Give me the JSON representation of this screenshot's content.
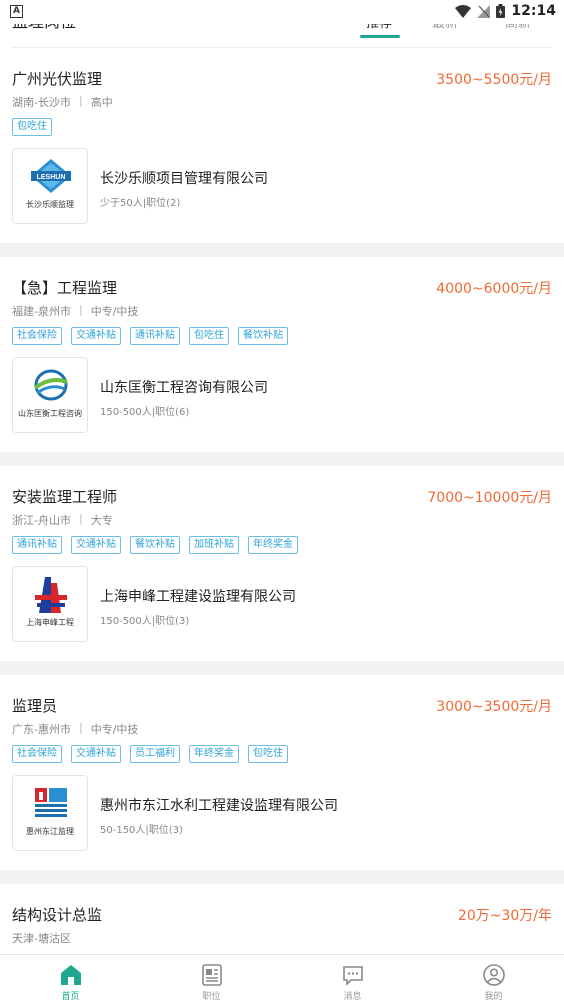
{
  "status": {
    "app_badge": "A",
    "time": "12:14"
  },
  "tabs": {
    "title": "监理岗位",
    "items": [
      {
        "label": "推荐",
        "active": true
      },
      {
        "label": "最新",
        "active": false
      },
      {
        "label": "高薪",
        "active": false
      }
    ]
  },
  "jobs": [
    {
      "title": "广州光伏监理",
      "salary": "3500~5500元/月",
      "location": "湖南-长沙市",
      "education": "高中",
      "tags": [
        "包吃住"
      ],
      "company": {
        "name": "长沙乐顺项目管理有限公司",
        "info": "少于50人|职位(2)",
        "logo_text": "长沙乐顺监理",
        "logo_mark": "LESHUN"
      }
    },
    {
      "title": "【急】工程监理",
      "salary": "4000~6000元/月",
      "location": "福建-泉州市",
      "education": "中专/中技",
      "tags": [
        "社会保险",
        "交通补贴",
        "通讯补贴",
        "包吃住",
        "餐饮补贴"
      ],
      "company": {
        "name": "山东匡衡工程咨询有限公司",
        "info": "150-500人|职位(6)",
        "logo_text": "山东匡衡工程咨询"
      }
    },
    {
      "title": "安装监理工程师",
      "salary": "7000~10000元/月",
      "location": "浙江-舟山市",
      "education": "大专",
      "tags": [
        "通讯补贴",
        "交通补贴",
        "餐饮补贴",
        "加班补贴",
        "年终奖金"
      ],
      "company": {
        "name": "上海申峰工程建设监理有限公司",
        "info": "150-500人|职位(3)",
        "logo_text": "上海申峰工程"
      }
    },
    {
      "title": "监理员",
      "salary": "3000~3500元/月",
      "location": "广东-惠州市",
      "education": "中专/中技",
      "tags": [
        "社会保险",
        "交通补贴",
        "员工福利",
        "年终奖金",
        "包吃住"
      ],
      "company": {
        "name": "惠州市东江水利工程建设监理有限公司",
        "info": "50-150人|职位(3)",
        "logo_text": "惠州东江监理"
      }
    },
    {
      "title": "结构设计总监",
      "salary": "20万~30万/年",
      "location": "天津-塘沽区"
    }
  ],
  "nav": [
    {
      "label": "首页",
      "icon": "home-icon",
      "active": true
    },
    {
      "label": "职位",
      "icon": "job-list-icon",
      "active": false
    },
    {
      "label": "消息",
      "icon": "message-icon",
      "active": false
    },
    {
      "label": "我的",
      "icon": "profile-icon",
      "active": false
    }
  ],
  "colors": {
    "accent": "#1fa88f",
    "salary": "#f06a35",
    "tag": "#2ea3d6"
  }
}
